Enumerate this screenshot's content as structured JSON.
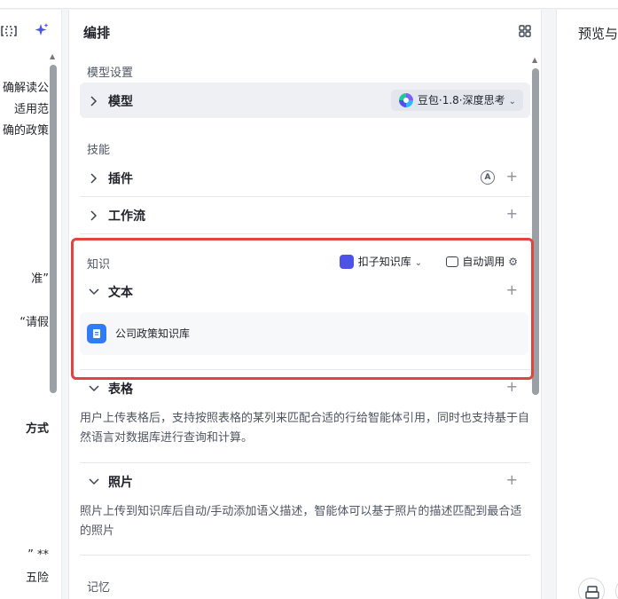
{
  "left": {
    "lines": [
      "确解读公",
      "适用范",
      "确的政策",
      "准”",
      "“请假",
      "方式",
      "”  **",
      "五险"
    ]
  },
  "editor": {
    "title": "编排",
    "model_settings": {
      "label": "模型设置",
      "row_label": "模型",
      "model_name": "豆包·1.8·深度思考"
    },
    "skills": {
      "label": "技能",
      "plugin_label": "插件",
      "workflow_label": "工作流",
      "auto_badge": "A"
    },
    "knowledge": {
      "label": "知识",
      "source": "扣子知识库",
      "auto_call": "自动调用",
      "text_label": "文本",
      "doc_name": "公司政策知识库",
      "table_label": "表格",
      "table_desc": "用户上传表格后，支持按照表格的某列来匹配合适的行给智能体引用，同时也支持基于自然语言对数据库进行查询和计算。",
      "photo_label": "照片",
      "photo_desc": "照片上传到知识库后自动/手动添加语义描述，智能体可以基于照片的描述匹配到最合适的照片"
    },
    "memory": {
      "label": "记忆"
    },
    "plus": "+"
  },
  "preview": {
    "title": "预览与"
  },
  "colors": {
    "accent": "#4d53e8",
    "highlight_border": "#e0443e",
    "doc_icon": "#2f7cf6"
  }
}
